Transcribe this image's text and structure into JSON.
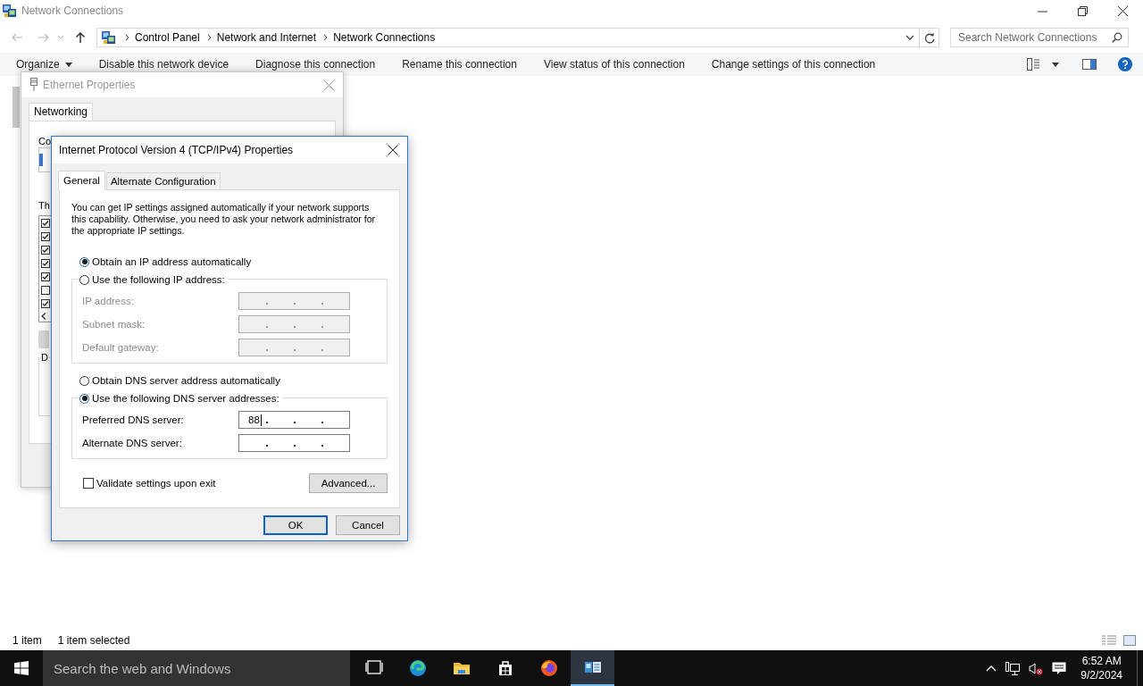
{
  "explorer": {
    "title": "Network Connections",
    "breadcrumb": [
      "Control Panel",
      "Network and Internet",
      "Network Connections"
    ],
    "search": {
      "placeholder": "Search Network Connections"
    },
    "commands": [
      {
        "label": "Organize",
        "kind": "menu"
      },
      {
        "label": "Disable this network device",
        "kind": "action"
      },
      {
        "label": "Diagnose this connection",
        "kind": "action"
      },
      {
        "label": "Rename this connection",
        "kind": "action"
      },
      {
        "label": "View status of this connection",
        "kind": "action"
      },
      {
        "label": "Change settings of this connection",
        "kind": "action"
      }
    ],
    "status": [
      "1 item",
      "1 item selected"
    ]
  },
  "ethernet_dialog": {
    "title": "Ethernet Properties",
    "tabs": [
      {
        "label": "Networking",
        "selected": true
      }
    ],
    "connect_label": "Co",
    "list_label": "Th",
    "group_label": "D",
    "components": [
      {
        "checked": true
      },
      {
        "checked": true
      },
      {
        "checked": true
      },
      {
        "checked": true
      },
      {
        "checked": true
      },
      {
        "checked": false
      },
      {
        "checked": true
      }
    ]
  },
  "ipv4_dialog": {
    "title": "Internet Protocol Version 4 (TCP/IPv4) Properties",
    "tabs": [
      {
        "label": "General",
        "selected": true
      },
      {
        "label": "Alternate Configuration",
        "selected": false
      }
    ],
    "intro": "You can get IP settings assigned automatically if your network supports this capability. Otherwise, you need to ask your network administrator for the appropriate IP settings.",
    "ip_options": [
      {
        "label": "Obtain an IP address automatically",
        "selected": true
      },
      {
        "label": "Use the following IP address:",
        "selected": false
      }
    ],
    "ip_fields": [
      {
        "label": "IP address:",
        "disabled": true
      },
      {
        "label": "Subnet mask:",
        "disabled": true
      },
      {
        "label": "Default gateway:",
        "disabled": true
      }
    ],
    "dns_options": [
      {
        "label": "Obtain DNS server address automatically",
        "selected": false
      },
      {
        "label": "Use the following DNS server addresses:",
        "selected": true
      }
    ],
    "dns_fields": [
      {
        "label": "Preferred DNS server:",
        "value": "88",
        "disabled": false,
        "focused": true
      },
      {
        "label": "Alternate DNS server:",
        "disabled": false,
        "focused": false
      }
    ],
    "validate": {
      "label": "Validate settings upon exit",
      "checked": false
    },
    "advanced_button": "Advanced...",
    "buttons": [
      {
        "label": "OK",
        "kind": "default"
      },
      {
        "label": "Cancel",
        "kind": "normal"
      }
    ]
  },
  "taskbar": {
    "search": {
      "placeholder": "Search the web and Windows"
    },
    "apps": [
      {
        "kind": "task-view",
        "selected": false
      },
      {
        "kind": "browser",
        "selected": false
      },
      {
        "kind": "folder",
        "selected": false
      },
      {
        "kind": "store",
        "selected": false
      },
      {
        "kind": "fox",
        "selected": false
      },
      {
        "kind": "network",
        "selected": true
      }
    ],
    "time": "6:52 AM",
    "date": "9/2/2024"
  }
}
